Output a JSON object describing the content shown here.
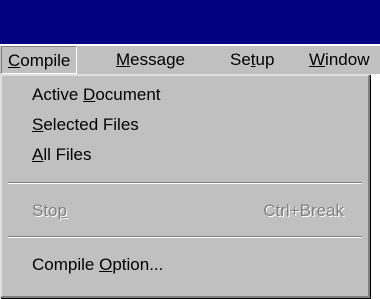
{
  "menubar": {
    "items": [
      {
        "label": "Compile",
        "accel": "C",
        "rest": "ompile"
      },
      {
        "label": "Message",
        "accel": "M",
        "rest": "essage"
      },
      {
        "label": "Setup",
        "pre": "Se",
        "accel": "t",
        "rest": "up"
      },
      {
        "label": "Window",
        "accel": "W",
        "rest": "indow"
      }
    ]
  },
  "compile_menu": {
    "active_document": {
      "pre": "Active ",
      "accel": "D",
      "rest": "ocument"
    },
    "selected_files": {
      "accel": "S",
      "rest": "elected Files"
    },
    "all_files": {
      "accel": "A",
      "rest": "ll Files"
    },
    "stop": {
      "pre": "Sto",
      "accel": "p",
      "shortcut": "Ctrl+Break",
      "enabled": false
    },
    "compile_option": {
      "pre": "Compile ",
      "accel": "O",
      "rest": "ption..."
    }
  },
  "colors": {
    "titlebar": "#000080",
    "menu_face": "#c0c0c0",
    "disabled_text": "#808080"
  }
}
